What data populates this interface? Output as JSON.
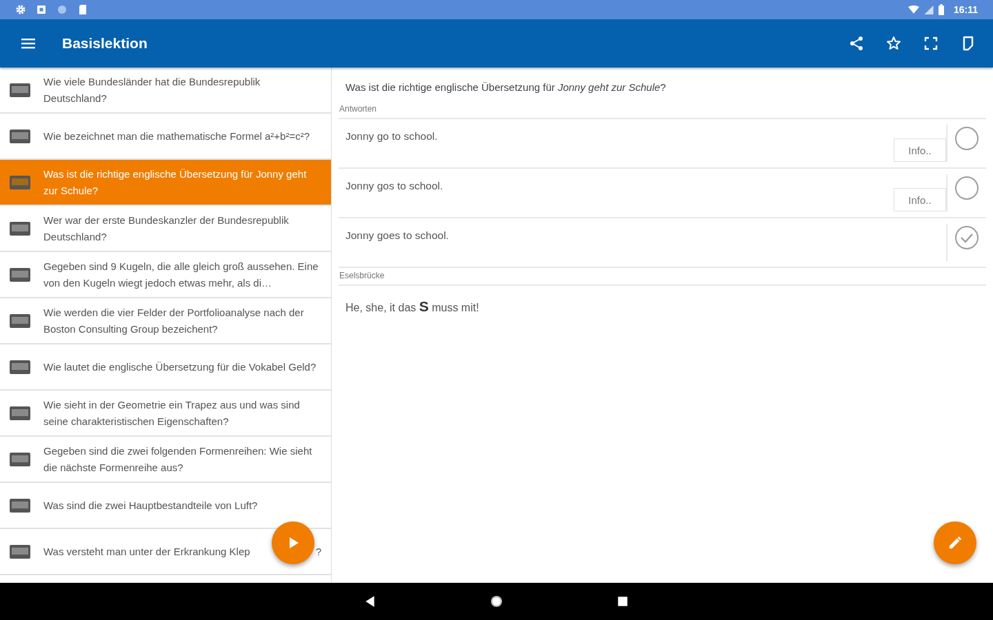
{
  "status_bar": {
    "time": "16:11"
  },
  "app_bar": {
    "title": "Basislektion"
  },
  "questions": [
    {
      "text": "Wie viele Bundesländer hat die Bundesrepublik Deutschland?",
      "selected": false
    },
    {
      "text": "Wie bezeichnet man die mathematische Formel a²+b²=c²?",
      "selected": false
    },
    {
      "text": "Was ist die richtige englische Übersetzung für Jonny geht zur Schule?",
      "selected": true
    },
    {
      "text": "Wer war der erste Bundeskanzler der Bundesrepublik Deutschland?",
      "selected": false
    },
    {
      "text": "Gegeben sind 9 Kugeln, die alle gleich groß aussehen. Eine von den Kugeln wiegt jedoch etwas mehr, als di…",
      "selected": false
    },
    {
      "text": "Wie werden die vier Felder der Portfolioanalyse nach der Boston Consulting Group bezeichent?",
      "selected": false
    },
    {
      "text": "Wie lautet die englische Übersetzung für die Vokabel Geld?",
      "selected": false
    },
    {
      "text": "Wie sieht in der Geometrie ein Trapez aus und was sind seine charakteristischen Eigenschaften?",
      "selected": false
    },
    {
      "text": "Gegeben sind die zwei folgenden Formenreihen: Wie sieht die nächste Formenreihe aus?",
      "selected": false
    },
    {
      "text": "Was sind die zwei Hauptbestandteile von Luft?",
      "selected": false
    },
    {
      "text": "Was versteht man unter der Erkrankung Klep",
      "tail": "?",
      "selected": false
    }
  ],
  "detail": {
    "question": "Was ist die richtige englische Übersetzung für *Jonny geht zur Schule*?",
    "answers_label": "Antworten",
    "answers": [
      {
        "text": "Jonny go to school.",
        "info": "Info..",
        "checked": false
      },
      {
        "text": "Jonny gos to school.",
        "info": "Info..",
        "checked": false
      },
      {
        "text": "Jonny goes to school.",
        "checked": true
      }
    ],
    "mnemonic_label": "Eselsbrücke",
    "mnemonic": "He, she, it das **S** muss mit!"
  }
}
